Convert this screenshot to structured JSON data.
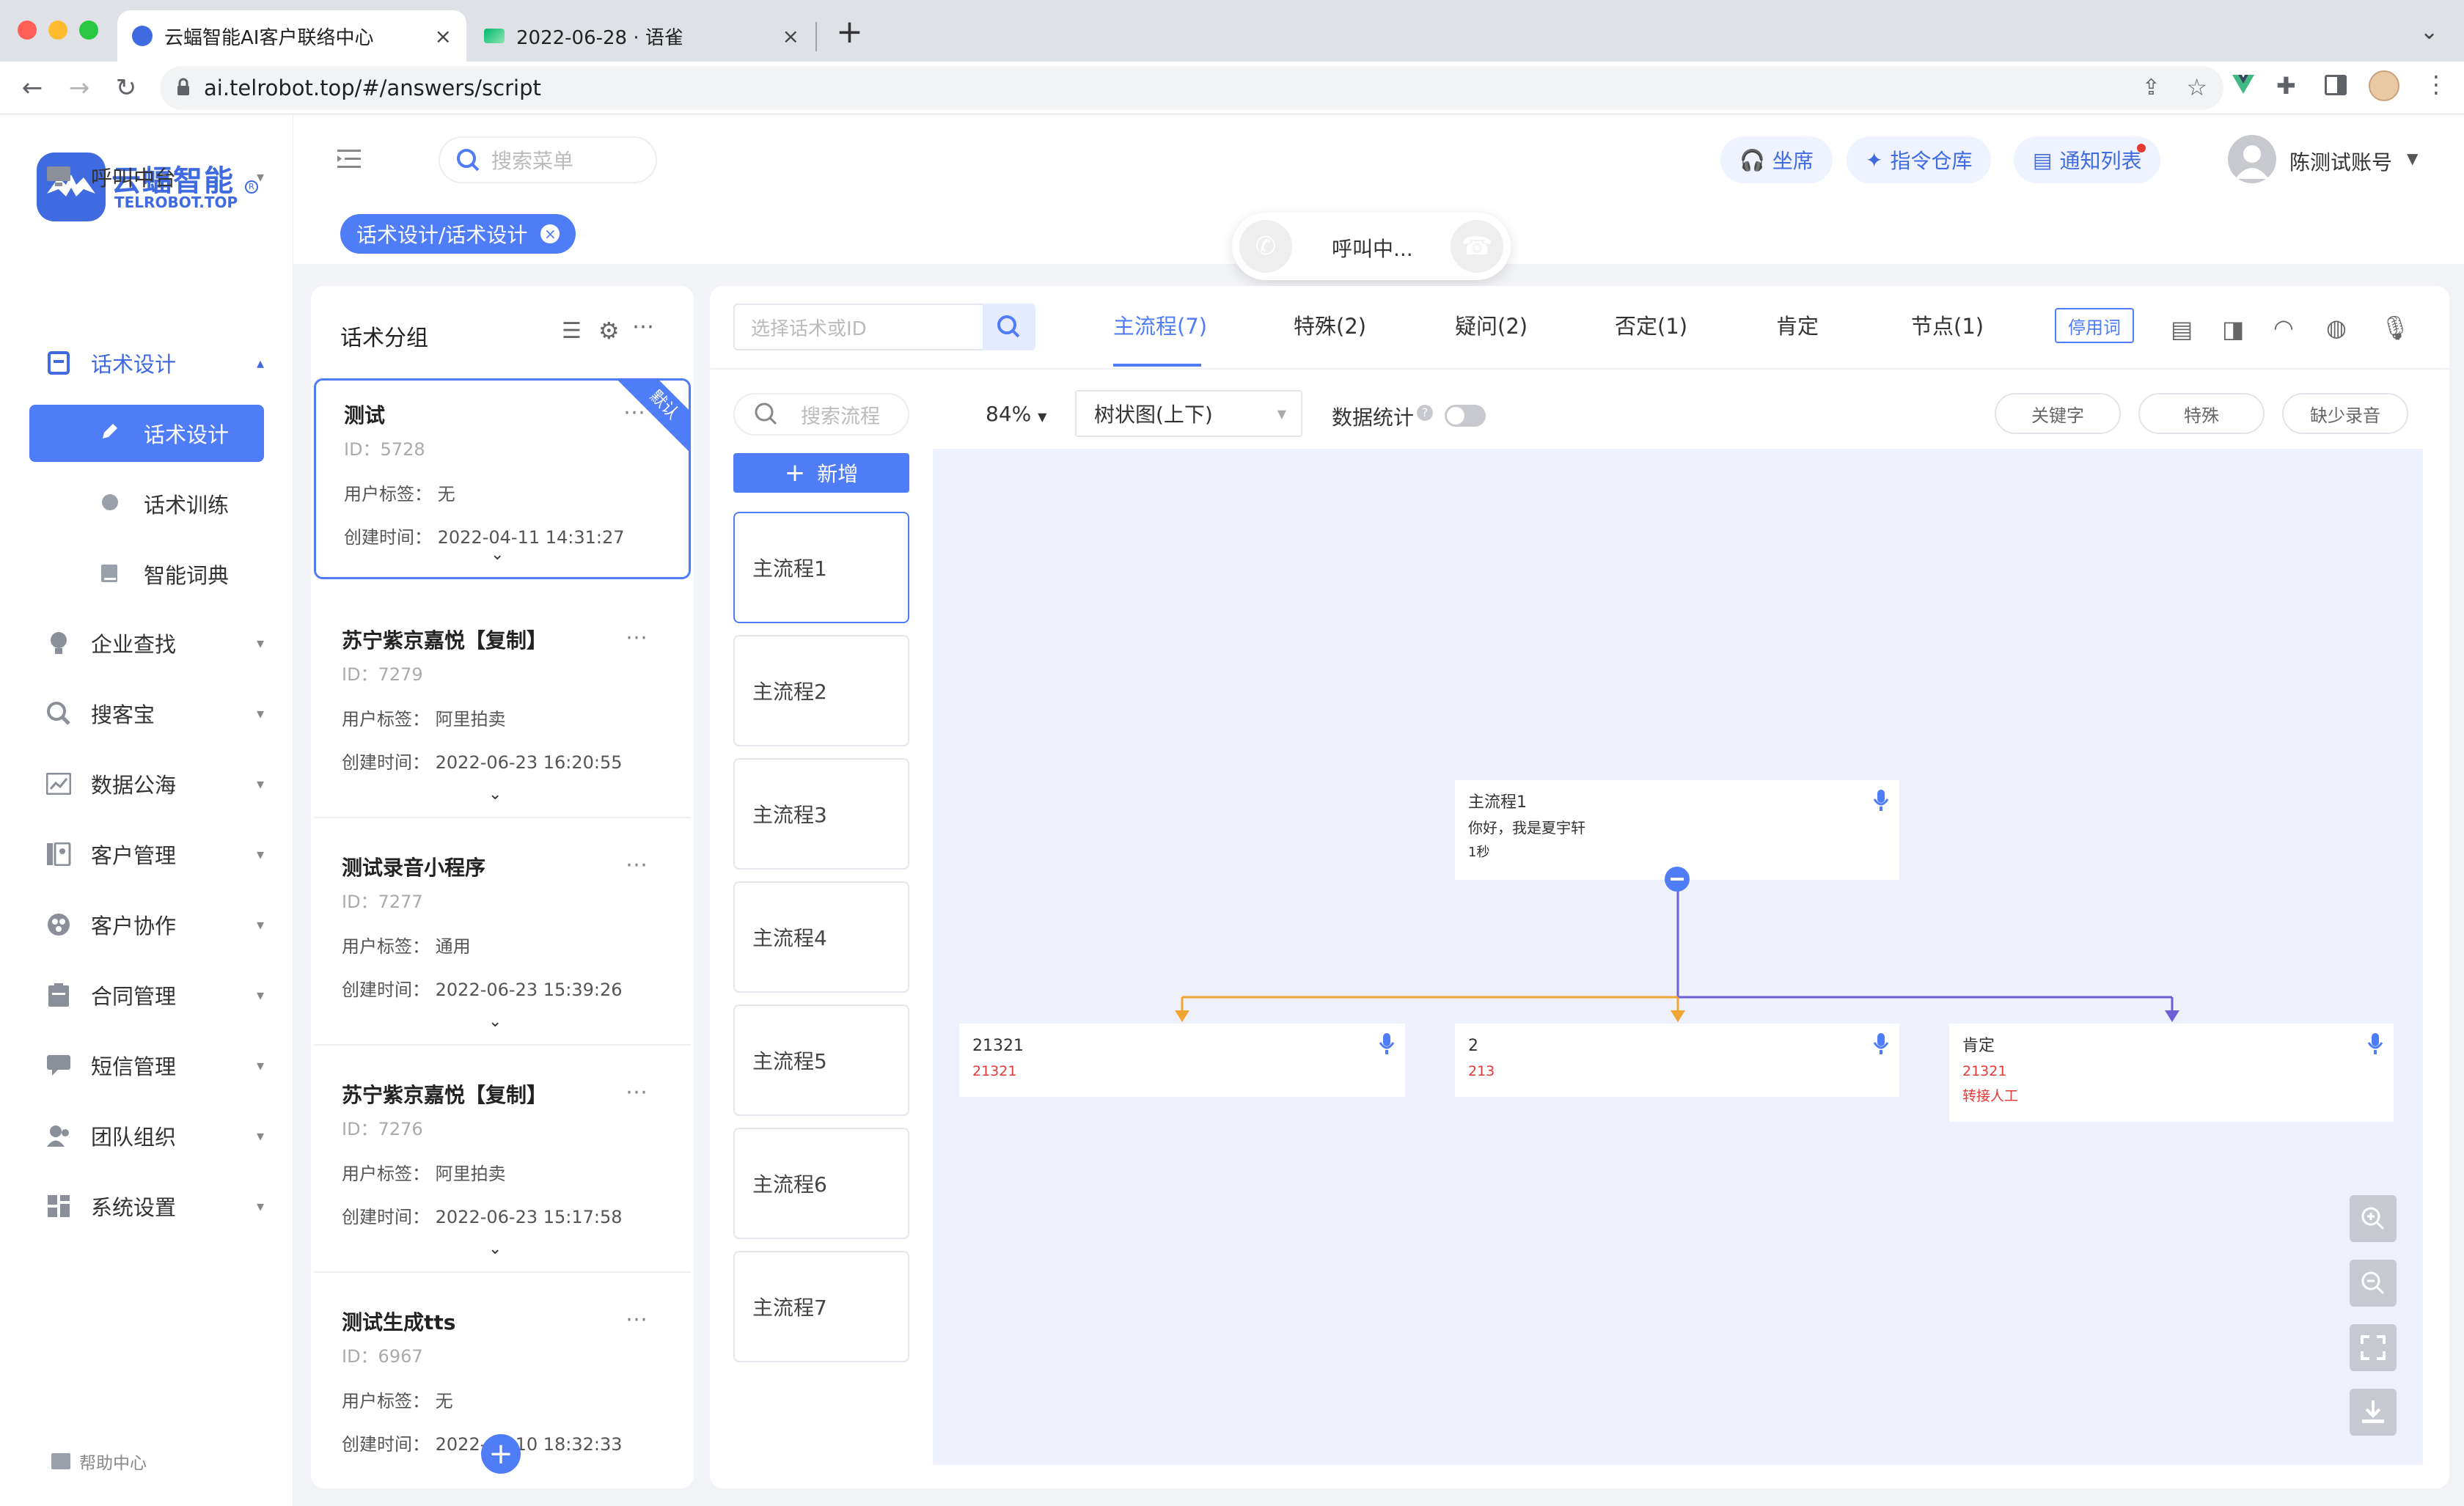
{
  "browser": {
    "tabs": [
      {
        "title": "云蝠智能AI客户联络中心",
        "active": true
      },
      {
        "title": "2022-06-28 · 语雀",
        "active": false
      }
    ],
    "url": "ai.telrobot.top/#/answers/script",
    "new_tab": "+"
  },
  "brand": {
    "name": "云蝠智能",
    "sub": "TELROBOT.TOP"
  },
  "sidebar": {
    "items": [
      {
        "label": "呼叫中台"
      },
      {
        "label": "话术设计"
      },
      {
        "label": "企业查找"
      },
      {
        "label": "搜客宝"
      },
      {
        "label": "数据公海"
      },
      {
        "label": "客户管理"
      },
      {
        "label": "客户协作"
      },
      {
        "label": "合同管理"
      },
      {
        "label": "短信管理"
      },
      {
        "label": "团队组织"
      },
      {
        "label": "系统设置"
      }
    ],
    "sub_items": [
      {
        "label": "话术设计",
        "active": true
      },
      {
        "label": "话术训练"
      },
      {
        "label": "智能词典"
      }
    ],
    "help": "帮助中心"
  },
  "header": {
    "search_placeholder": "搜索菜单",
    "seat": "坐席",
    "command": "指令仓库",
    "notify": "通知列表",
    "user": "陈测试账号"
  },
  "breadcrumb_tag": "话术设计/话术设计",
  "call": {
    "status": "呼叫中..."
  },
  "groups": {
    "title": "话术分组",
    "default_badge": "默认",
    "tag_label": "用户标签：",
    "time_label": "创建时间：",
    "items": [
      {
        "name": "测试",
        "id": "ID：5728",
        "tag": "无",
        "time": "2022-04-11 14:31:27"
      },
      {
        "name": "苏宁紫京嘉悦【复制】",
        "id": "ID：7279",
        "tag": "阿里拍卖",
        "time": "2022-06-23 16:20:55"
      },
      {
        "name": "测试录音小程序",
        "id": "ID：7277",
        "tag": "通用",
        "time": "2022-06-23 15:39:26"
      },
      {
        "name": "苏宁紫京嘉悦【复制】",
        "id": "ID：7276",
        "tag": "阿里拍卖",
        "time": "2022-06-23 15:17:58"
      },
      {
        "name": "测试生成tts",
        "id": "ID：6967",
        "tag": "无",
        "time": "2022-06-10 18:32:33"
      }
    ]
  },
  "editor": {
    "select_placeholder": "选择话术或ID",
    "tabs": [
      {
        "label": "主流程(7)",
        "active": true
      },
      {
        "label": "特殊(2)"
      },
      {
        "label": "疑问(2)"
      },
      {
        "label": "否定(1)"
      },
      {
        "label": "肯定"
      },
      {
        "label": "节点(1)"
      }
    ],
    "stopword": "停用词",
    "flow_search_placeholder": "搜索流程",
    "add": "新增",
    "flows": [
      "主流程1",
      "主流程2",
      "主流程3",
      "主流程4",
      "主流程5",
      "主流程6",
      "主流程7"
    ],
    "zoom": "84%",
    "view": "树状图(上下)",
    "stats": "数据统计",
    "chips": [
      "关键字",
      "特殊",
      "缺少录音"
    ]
  },
  "tree": {
    "root": {
      "title": "主流程1",
      "text": "你好，我是夏宇轩",
      "dur": "1秒"
    },
    "children": [
      {
        "title": "21321",
        "sub": "21321",
        "color": "#f0a633"
      },
      {
        "title": "2",
        "sub": "213",
        "color": "#f0a633"
      },
      {
        "title": "肯定",
        "sub": "21321",
        "extra": "转接人工",
        "color": "#6b5fd6"
      }
    ]
  },
  "colors": {
    "primary": "#4f7cf7",
    "red": "#e53935",
    "orange": "#f0a633",
    "purple": "#6b5fd6"
  }
}
